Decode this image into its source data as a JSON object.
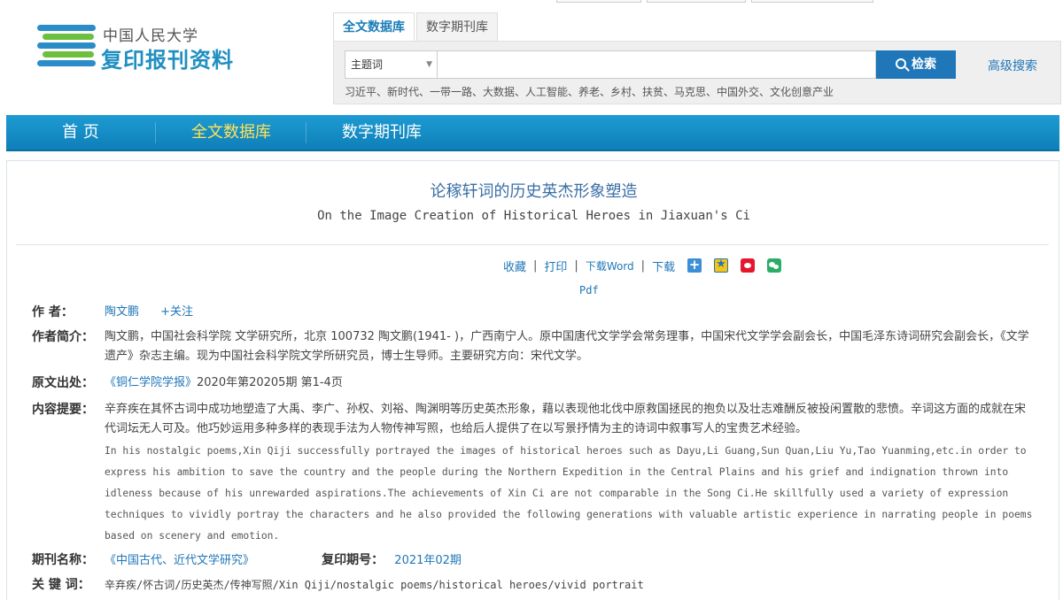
{
  "site": {
    "name_small": "中国人民大学",
    "name_big": "复印报刊资料",
    "colors": {
      "brand": "#1f8fc2",
      "accent": "#1f76b8",
      "nav_current": "#ffe25a"
    }
  },
  "search": {
    "tabs": [
      {
        "label": "全文数据库",
        "active": true
      },
      {
        "label": "数字期刊库",
        "active": false
      }
    ],
    "field_selected": "主题词",
    "query_value": "",
    "button_label": "检索",
    "advanced_label": "高级搜索",
    "hot_words": "习近平、新时代、一带一路、大数据、人工智能、养老、乡村、扶贫、马克思、中国外交、文化创意产业"
  },
  "nav": {
    "items": [
      {
        "label": "首 页",
        "current": false
      },
      {
        "label": "全文数据库",
        "current": true
      },
      {
        "label": "数字期刊库",
        "current": false
      }
    ]
  },
  "article": {
    "title_cn": "论稼轩词的历史英杰形象塑造",
    "title_en": "On the Image Creation of Historical Heroes in Jiaxuan's Ci",
    "tools": {
      "favorite": "收藏",
      "print": "打印",
      "download_word": "下载Word",
      "download": "下载",
      "pdf": "Pdf",
      "separator": "|"
    },
    "author_label": "作 者：",
    "author": "陶文鹏",
    "follow": "+关注",
    "bio_label": "作者简介：",
    "bio": "陶文鹏，中国社会科学院 文学研究所，北京 100732 陶文鹏(1941- )，广西南宁人。原中国唐代文学学会常务理事，中国宋代文学学会副会长，中国毛泽东诗词研究会副会长，《文学遗产》杂志主编。现为中国社会科学院文学所研究员，博士生导师。主要研究方向：宋代文学。",
    "source_label": "原文出处：",
    "source_journal": "《铜仁学院学报》",
    "source_issue": "2020年第20205期 第1-4页",
    "abstract_label": "内容提要：",
    "abstract_cn": "辛弃疾在其怀古词中成功地塑造了大禹、李广、孙权、刘裕、陶渊明等历史英杰形象，藉以表现他北伐中原救国拯民的抱负以及壮志难酬反被投闲置散的悲愤。辛词这方面的成就在宋代词坛无人可及。他巧妙运用多种多样的表现手法为人物传神写照，也给后人提供了在以写景抒情为主的诗词中叙事写人的宝贵艺术经验。",
    "abstract_en": "In his nostalgic poems,Xin Qiji successfully portrayed the images of historical heroes such as Dayu,Li Guang,Sun Quan,Liu Yu,Tao Yuanming,etc.in order to express his ambition to save the country and the people during the Northern Expedition in the Central Plains and his grief and indignation thrown into idleness because of his unrewarded aspirations.The achievements of Xin Ci are not comparable in the Song Ci.He skillfully used a variety of expression techniques to vividly portray the characters and he also provided the following generations with valuable artistic experience in narrating people in poems based on scenery and emotion.",
    "journal_label": "期刊名称：",
    "journal": "《中国古代、近代文学研究》",
    "reprint_label": "复印期号：",
    "reprint_issue": "2021年02期",
    "keywords_label": "关 键 词：",
    "keywords": "辛弃疾/怀古词/历史英杰/传神写照/Xin Qiji/nostalgic poems/historical heroes/vivid portrait"
  }
}
